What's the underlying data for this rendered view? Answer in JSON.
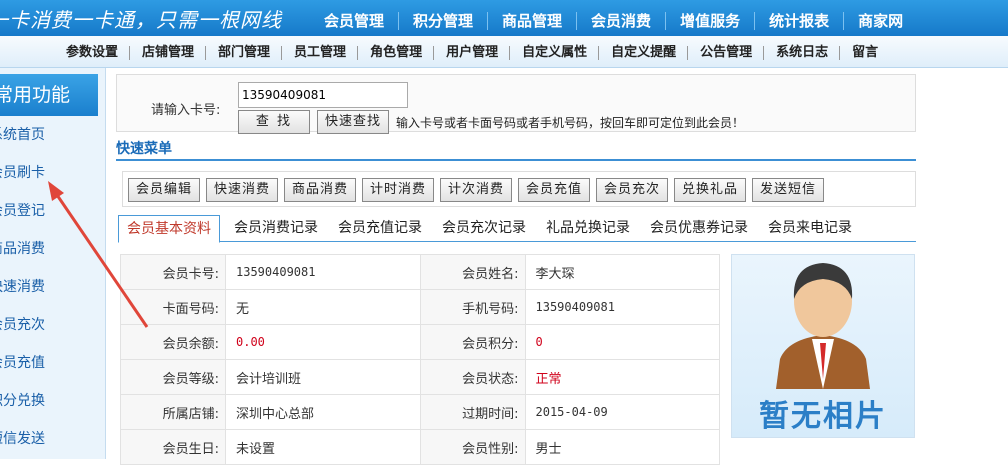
{
  "header": {
    "slogan": "一卡消费一卡通，只需一根网线",
    "nav": [
      "会员管理",
      "积分管理",
      "商品管理",
      "会员消费",
      "增值服务",
      "统计报表",
      "商家网"
    ]
  },
  "subnav": [
    "参数设置",
    "店铺管理",
    "部门管理",
    "员工管理",
    "角色管理",
    "用户管理",
    "自定义属性",
    "自定义提醒",
    "公告管理",
    "系统日志",
    "留言"
  ],
  "sidebar": {
    "title": "常用功能",
    "items": [
      "系统首页",
      "会员刷卡",
      "会员登记",
      "商品消费",
      "快速消费",
      "会员充次",
      "会员充值",
      "积分兑换",
      "短信发送"
    ]
  },
  "search": {
    "label": "请输入卡号:",
    "value": "13590409081",
    "find_label": "查 找",
    "quick_find_label": "快速查找",
    "hint": "输入卡号或者卡面号码或者手机号码，按回车即可定位到此会员！"
  },
  "quick_menu": {
    "title": "快速菜单",
    "buttons": [
      "会员编辑",
      "快速消费",
      "商品消费",
      "计时消费",
      "计次消费",
      "会员充值",
      "会员充次",
      "兑换礼品",
      "发送短信"
    ]
  },
  "tabs": [
    "会员基本资料",
    "会员消费记录",
    "会员充值记录",
    "会员充次记录",
    "礼品兑换记录",
    "会员优惠券记录",
    "会员来电记录"
  ],
  "member": {
    "rows": [
      [
        {
          "label": "会员卡号:",
          "value": "13590409081"
        },
        {
          "label": "会员姓名:",
          "value": "李大琛"
        }
      ],
      [
        {
          "label": "卡面号码:",
          "value": "无"
        },
        {
          "label": "手机号码:",
          "value": "13590409081"
        }
      ],
      [
        {
          "label": "会员余额:",
          "value": "0.00"
        },
        {
          "label": "会员积分:",
          "value": "0"
        }
      ],
      [
        {
          "label": "会员等级:",
          "value": "会计培训班"
        },
        {
          "label": "会员状态:",
          "value": "正常"
        }
      ],
      [
        {
          "label": "所属店铺:",
          "value": "深圳中心总部"
        },
        {
          "label": "过期时间:",
          "value": "2015-04-09"
        }
      ],
      [
        {
          "label": "会员生日:",
          "value": "未设置"
        },
        {
          "label": "会员性别:",
          "value": "男士"
        }
      ]
    ]
  },
  "photo": {
    "caption": "暂无相片"
  },
  "colors": {
    "accent": "#1a7fcd",
    "warning": "#d0021b",
    "arrow": "#e0463a"
  }
}
